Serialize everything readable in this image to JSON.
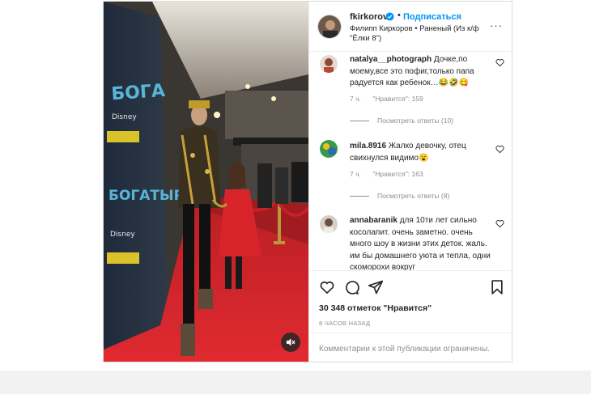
{
  "post": {
    "author": {
      "username": "fkirkorov",
      "verified": true,
      "follow_label": "Подписаться",
      "separator": "•",
      "subtitle": "Филипп Киркоров • Раненый (Из к/ф \"Ёлки 8\")"
    },
    "media": {
      "mute_icon": "speaker-muted-icon"
    },
    "comments": [
      {
        "username": "natalya__photograph",
        "text": "Дочке,по моему,все это пофиг,только папа радуется как ребенок…😂🤣😋",
        "age": "7 ч.",
        "likes": "\"Нравится\": 159",
        "replies": "Посмотреть ответы (10)"
      },
      {
        "username": "mila.8916",
        "text": "Жалко девочку, отец свихнулся видимо😮",
        "age": "7 ч.",
        "likes": "\"Нравится\": 163",
        "replies": "Посмотреть ответы (8)"
      },
      {
        "username": "annabaranik",
        "text": "для 10ти лет сильно косолапит. очень заметно. очень много шоу в жизни этих деток. жаль. им бы домашнего уюта и тепла, одни скоморохи вокруг"
      }
    ],
    "actions": {
      "like_icon": "heart-icon",
      "comment_icon": "comment-icon",
      "share_icon": "share-icon",
      "save_icon": "bookmark-icon"
    },
    "likes_text": "30 348 отметок \"Нравится\"",
    "posted_ago": "8 ЧАСОВ НАЗАД",
    "comments_limited": "Комментарии к этой публикации ограничены."
  },
  "colors": {
    "accent": "#0095f6",
    "secondary_text": "#8e8e8e",
    "border": "#dbdbdb",
    "carpet_red": "#d7252b"
  }
}
